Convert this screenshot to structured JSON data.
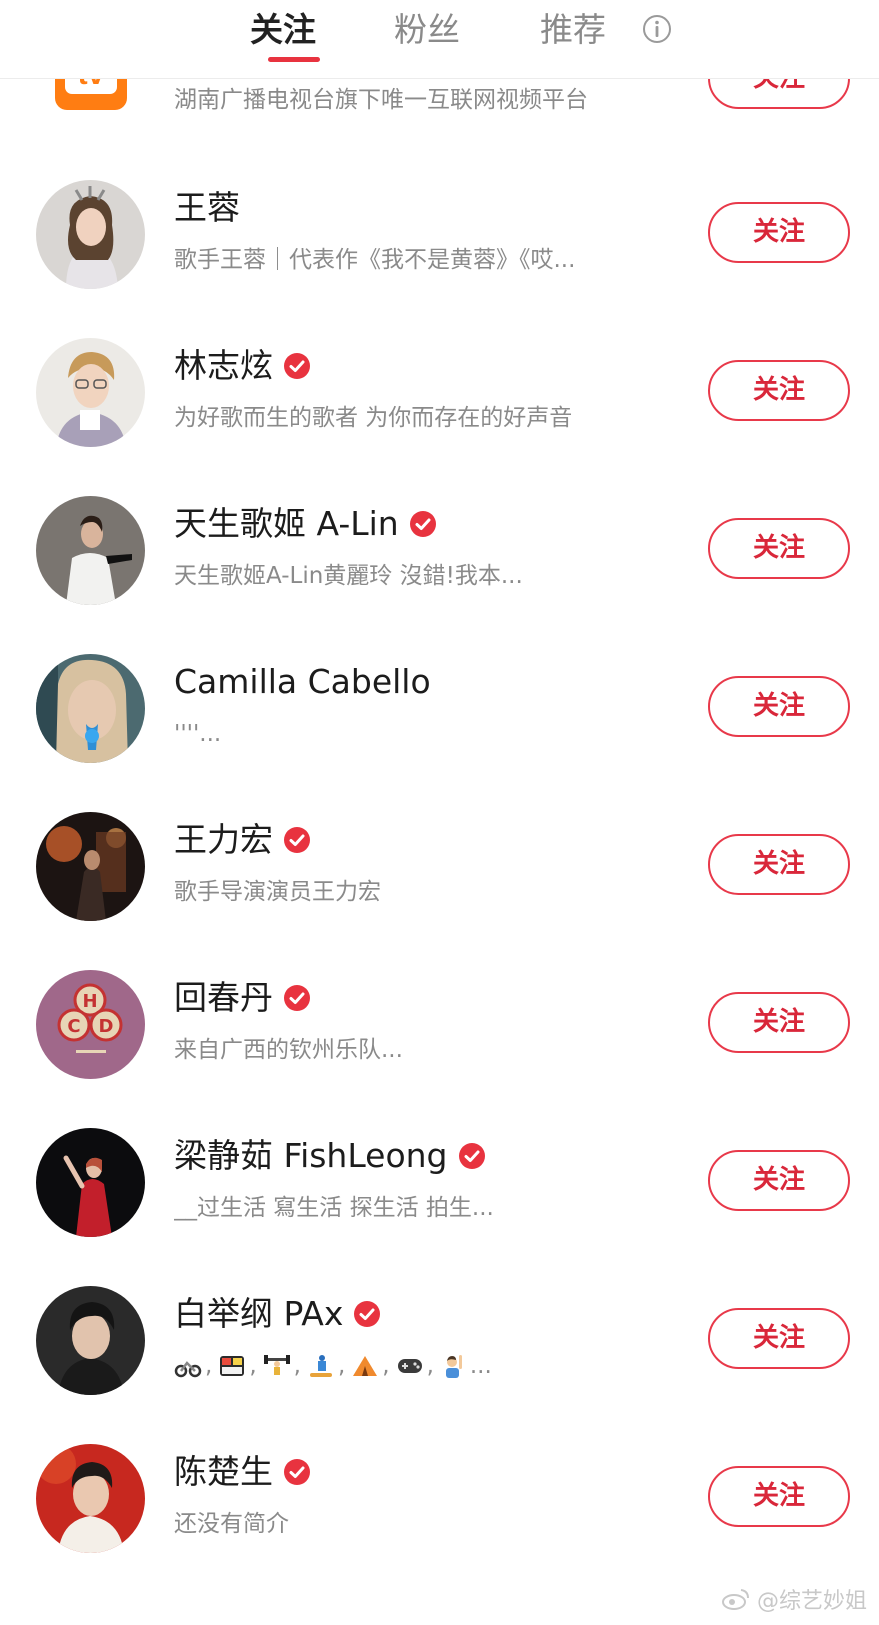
{
  "tabs": [
    {
      "label": "关注",
      "active": true
    },
    {
      "label": "粉丝",
      "active": false
    },
    {
      "label": "推荐",
      "active": false
    }
  ],
  "follow_label": "关注",
  "partial_row": {
    "desc": "湖南广播电视台旗下唯一互联网视频平台",
    "logo_text": "tv"
  },
  "users": [
    {
      "name": "王蓉",
      "verified": false,
      "desc": "歌手王蓉｜代表作《我不是黄蓉》《哎..."
    },
    {
      "name": "林志炫",
      "verified": true,
      "desc": "为好歌而生的歌者 为你而存在的好声音"
    },
    {
      "name": "天生歌姬 A-Lin",
      "verified": true,
      "desc": "天生歌姬A-Lin黄麗玲 沒錯!我本..."
    },
    {
      "name": "Camilla Cabello",
      "verified": false,
      "desc": "''''..."
    },
    {
      "name": "王力宏",
      "verified": true,
      "desc": "歌手导演演员王力宏"
    },
    {
      "name": "回春丹",
      "verified": true,
      "desc": "来自广西的钦州乐队..."
    },
    {
      "name": "梁静茹 FishLeong",
      "verified": true,
      "desc": "__过生活 寫生活  探生活 拍生..."
    },
    {
      "name": "白举纲 PAx",
      "verified": true,
      "desc_emojis": [
        "motorcycle",
        "bento",
        "weightlifter",
        "snowboarder",
        "tent",
        "game-controller",
        "person-raising-hand"
      ],
      "desc_suffix": "..."
    },
    {
      "name": "陈楚生",
      "verified": true,
      "desc": "还没有简介"
    }
  ],
  "avatar_logo_text": "HCD",
  "watermark": "@综艺妙姐",
  "colors": {
    "accent": "#e8333f",
    "verified": "#e8333f",
    "muted_text": "#8a8a8a"
  }
}
